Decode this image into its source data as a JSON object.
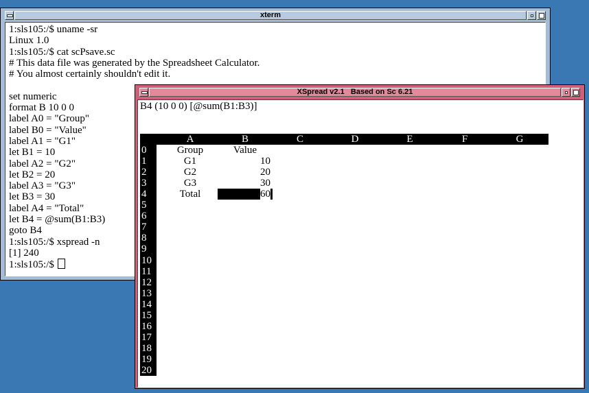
{
  "xterm": {
    "title": "xterm",
    "lines": [
      "1:sls105:/$ uname -sr",
      "Linux 1.0",
      "1:sls105:/$ cat scPsave.sc",
      "# This data file was generated by the Spreadsheet Calculator.",
      "# You almost certainly shouldn't edit it.",
      "",
      "set numeric",
      "format B 10 0 0",
      "label A0 = \"Group\"",
      "label B0 = \"Value\"",
      "label A1 = \"G1\"",
      "let B1 = 10",
      "label A2 = \"G2\"",
      "let B2 = 20",
      "label A3 = \"G3\"",
      "let B3 = 30",
      "label A4 = \"Total\"",
      "let B4 = @sum(B1:B3)",
      "goto B4",
      "1:sls105:/$ xspread -n",
      "[1] 240"
    ],
    "prompt": "1:sls105:/$"
  },
  "xspread": {
    "title": "XSpread v2.1   Based on Sc 6.21",
    "formula_line": "B4 (10 0 0) [@sum(B1:B3)]",
    "columns": [
      "A",
      "B",
      "C",
      "D",
      "E",
      "F",
      "G"
    ],
    "rows": [
      "0",
      "1",
      "2",
      "3",
      "4",
      "5",
      "6",
      "7",
      "8",
      "9",
      "10",
      "11",
      "12",
      "13",
      "14",
      "15",
      "16",
      "17",
      "18",
      "19",
      "20"
    ],
    "cells": {
      "A0": "Group",
      "B0": "Value",
      "A1": "G1",
      "B1": "10",
      "A2": "G2",
      "B2": "20",
      "A3": "G3",
      "B3": "30",
      "A4": "Total",
      "B4": "60"
    },
    "selected_cell": "B4"
  },
  "colors": {
    "desktop": "#3a78b4",
    "xterm_frame": "#a3bcd7",
    "xspread_frame": "#d0607a"
  }
}
